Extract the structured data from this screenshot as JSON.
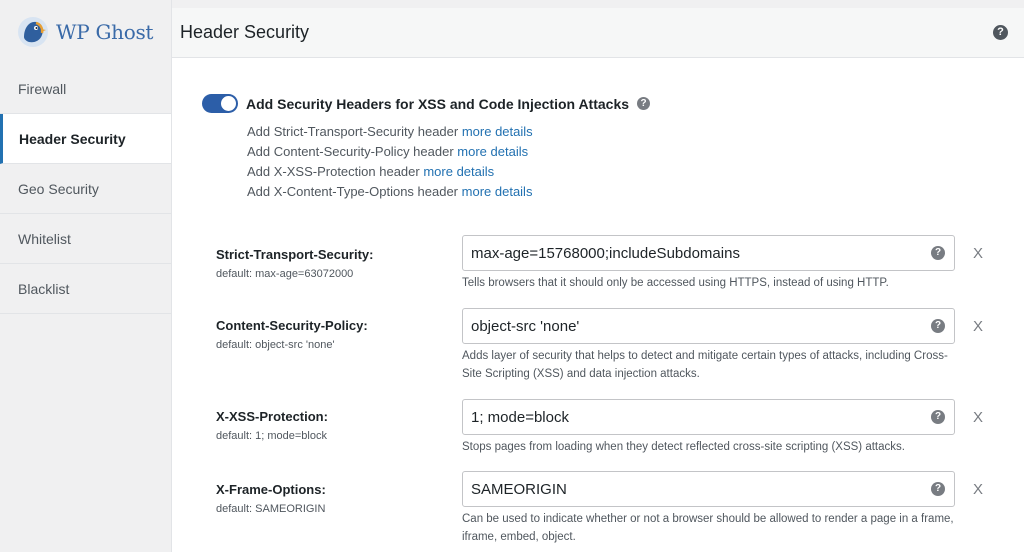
{
  "brand": {
    "name": "WP Ghost"
  },
  "sidebar": {
    "items": [
      {
        "label": "Firewall"
      },
      {
        "label": "Header Security"
      },
      {
        "label": "Geo Security"
      },
      {
        "label": "Whitelist"
      },
      {
        "label": "Blacklist"
      }
    ]
  },
  "header": {
    "title": "Header Security",
    "help": "?"
  },
  "toggle": {
    "label": "Add Security Headers for XSS and Code Injection Attacks",
    "state": "on",
    "help": "?"
  },
  "details": [
    {
      "text": "Add Strict-Transport-Security header",
      "link": "more details"
    },
    {
      "text": "Add Content-Security-Policy header",
      "link": "more details"
    },
    {
      "text": "Add X-XSS-Protection header",
      "link": "more details"
    },
    {
      "text": "Add X-Content-Type-Options header",
      "link": "more details"
    }
  ],
  "settings": [
    {
      "name": "Strict-Transport-Security:",
      "default": "default: max-age=63072000",
      "value": "max-age=15768000;includeSubdomains",
      "remove": "X",
      "description": "Tells browsers that it should only be accessed using HTTPS, instead of using HTTP."
    },
    {
      "name": "Content-Security-Policy:",
      "default": "default: object-src 'none'",
      "value": "object-src 'none'",
      "remove": "X",
      "description": "Adds layer of security that helps to detect and mitigate certain types of attacks, including Cross-Site Scripting (XSS) and data injection attacks."
    },
    {
      "name": "X-XSS-Protection:",
      "default": "default: 1; mode=block",
      "value": "1; mode=block",
      "remove": "X",
      "description": "Stops pages from loading when they detect reflected cross-site scripting (XSS) attacks."
    },
    {
      "name": "X-Frame-Options:",
      "default": "default: SAMEORIGIN",
      "value": "SAMEORIGIN",
      "remove": "X",
      "description": "Can be used to indicate whether or not a browser should be allowed to render a page in a frame, iframe, embed, object."
    }
  ],
  "colors": {
    "accent": "#2271b1",
    "toggle": "#2c5ea8"
  }
}
